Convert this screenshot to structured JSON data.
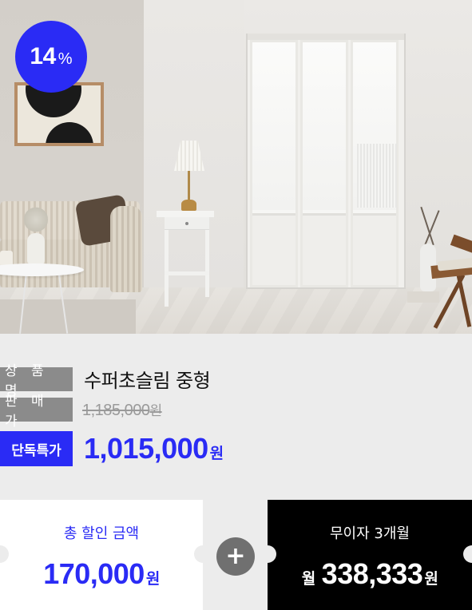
{
  "hero": {
    "discount_number": "14",
    "discount_unit": "%"
  },
  "product": {
    "name_label": "상 품 명",
    "name": "수퍼초슬림 중형",
    "price_label": "판 매 가",
    "original_price": "1,185,000",
    "original_price_unit": "원",
    "special_label": "단독특가",
    "special_price": "1,015,000",
    "special_price_unit": "원"
  },
  "discount_card": {
    "title": "총 할인 금액",
    "amount": "170,000",
    "unit": "원"
  },
  "plus_symbol": "+",
  "installment_card": {
    "title": "무이자 3개월",
    "prefix": "월",
    "amount": "338,333",
    "unit": "원"
  },
  "colors": {
    "accent_blue": "#2a2bf5",
    "label_gray": "#8b8b8b",
    "background": "#ececec"
  }
}
